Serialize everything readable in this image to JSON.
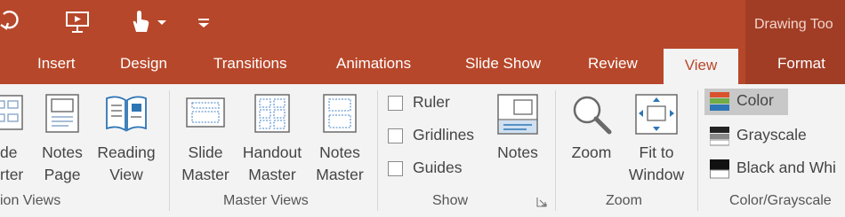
{
  "context_tab": {
    "label": "Drawing Too"
  },
  "qat": [
    {
      "name": "redo-icon"
    },
    {
      "name": "present-from-current-slide-icon"
    },
    {
      "name": "touch-mouse-mode-icon"
    },
    {
      "name": "customize-qat-icon"
    }
  ],
  "tabs": {
    "insert": "Insert",
    "design": "Design",
    "transitions": "Transitions",
    "animations": "Animations",
    "slideshow": "Slide Show",
    "review": "Review",
    "view": "View",
    "format": "Format"
  },
  "presentation_views": {
    "slide_sorter": {
      "line1": "de",
      "line2": "rter"
    },
    "notes_page": {
      "line1": "Notes",
      "line2": "Page"
    },
    "reading_view": {
      "line1": "Reading",
      "line2": "View"
    },
    "group_label": "ion Views"
  },
  "master_views": {
    "slide_master": {
      "line1": "Slide",
      "line2": "Master"
    },
    "handout_master": {
      "line1": "Handout",
      "line2": "Master"
    },
    "notes_master": {
      "line1": "Notes",
      "line2": "Master"
    },
    "group_label": "Master Views"
  },
  "show": {
    "ruler": "Ruler",
    "gridlines": "Gridlines",
    "guides": "Guides",
    "notes": "Notes",
    "group_label": "Show"
  },
  "zoom": {
    "zoom": "Zoom",
    "fit_line1": "Fit to",
    "fit_line2": "Window",
    "group_label": "Zoom"
  },
  "color_grayscale": {
    "color": "Color",
    "grayscale": "Grayscale",
    "black_white": "Black and Whi",
    "group_label": "Color/Grayscale"
  },
  "colors": {
    "accent": "#b7472a",
    "contextual": "#a13d25",
    "ribbon_bg": "#f3f3f3"
  }
}
